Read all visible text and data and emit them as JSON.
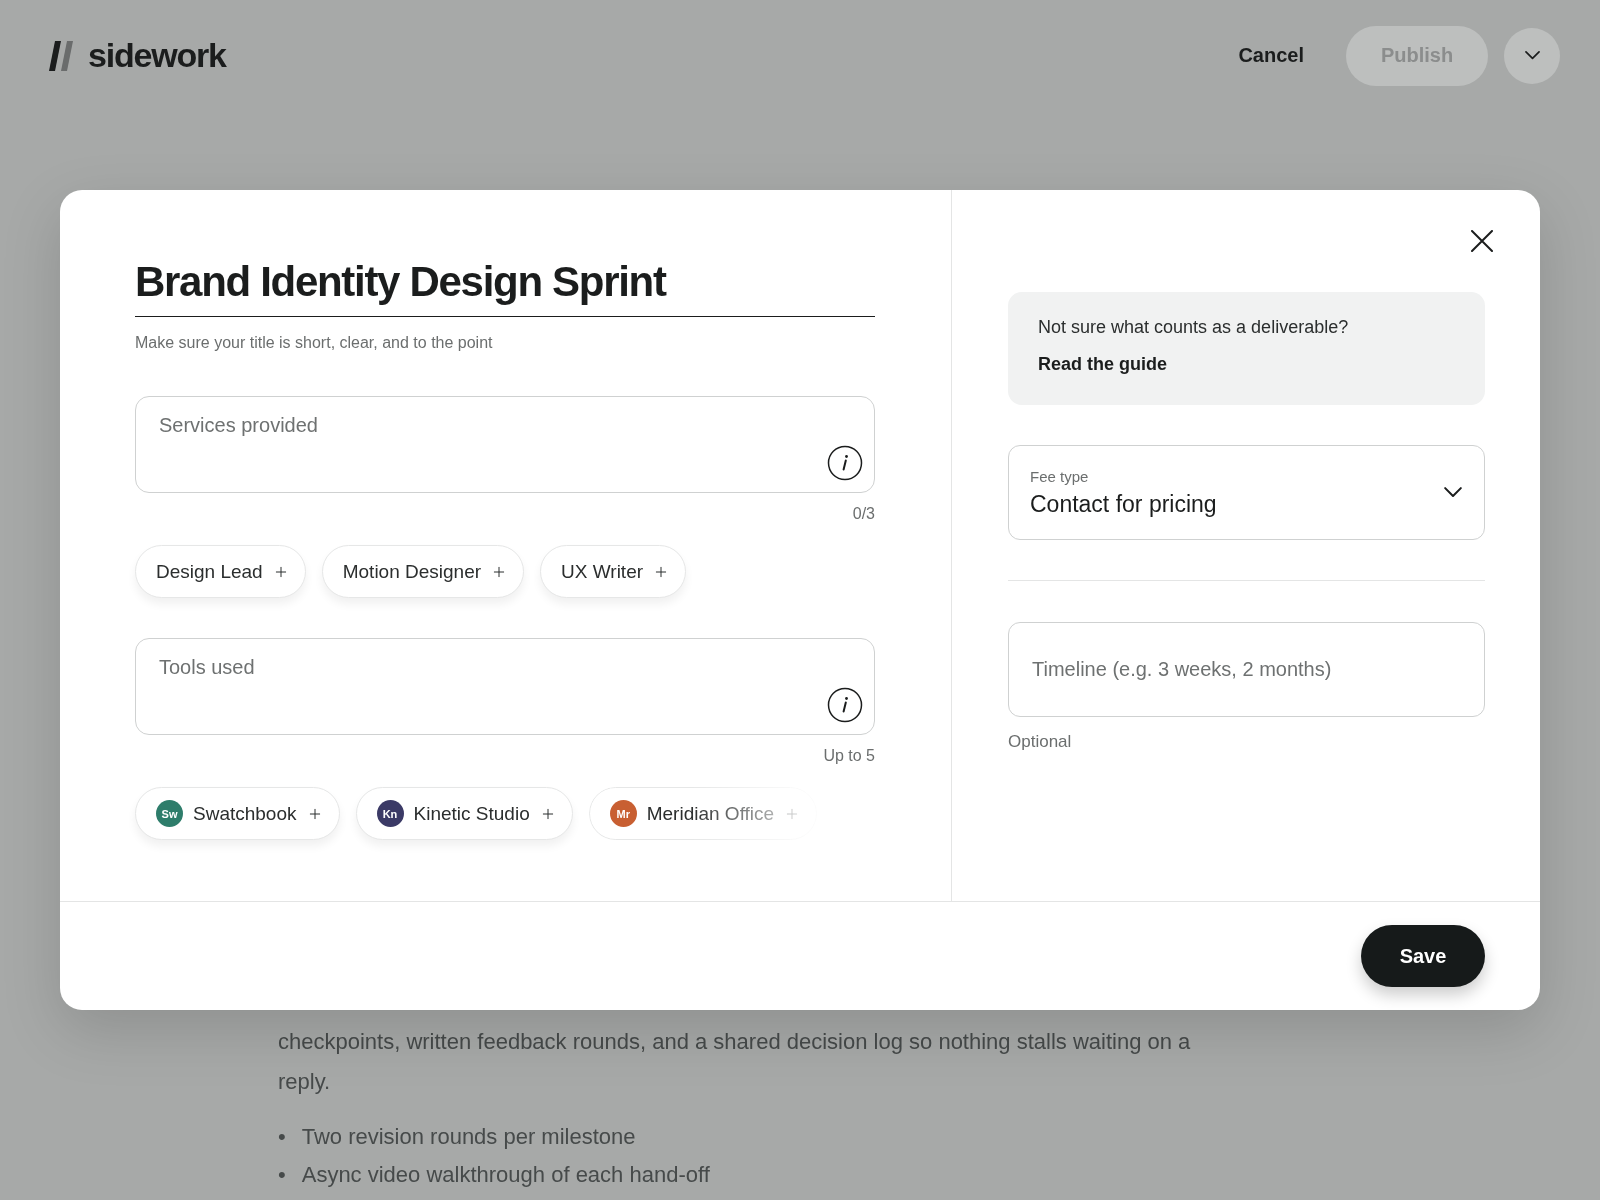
{
  "header": {
    "logo": "sidework",
    "cancel": "Cancel",
    "publish": {
      "label": "Publish",
      "disabled": true
    }
  },
  "background": {
    "paragraph": [
      "checkpoints, written feedback rounds, and a shared decision log so nothing stalls waiting on a",
      "reply."
    ],
    "bullets": [
      {
        "marker": "•",
        "text": "Two revision rounds per milestone"
      },
      {
        "marker": "•",
        "text": "Async video walkthrough of each hand-off"
      }
    ]
  },
  "dialog": {
    "title": {
      "value": "Brand Identity Design Sprint",
      "hint": "Make sure your title is short, clear, and to the point"
    },
    "services": {
      "placeholder": "Services provided",
      "counter": "0/3"
    },
    "service_chips": [
      {
        "label": "Design Lead"
      },
      {
        "label": "Motion Designer"
      },
      {
        "label": "UX Writer"
      }
    ],
    "tools": {
      "placeholder": "Tools used",
      "counter": "Up to 5"
    },
    "tool_chips": [
      {
        "label": "Swatchbook",
        "initials": "Sw",
        "color": "#2e7d6b",
        "faded": false
      },
      {
        "label": "Kinetic Studio",
        "initials": "Kn",
        "color": "#3b3a66",
        "faded": false
      },
      {
        "label": "Meridian Office",
        "initials": "Mr",
        "color": "#c85f32",
        "faded": true
      }
    ],
    "guide": {
      "text": "Not sure what counts as a deliverable?",
      "link": "Read the guide"
    },
    "fee_type": {
      "label": "Fee type",
      "value": "Contact for pricing"
    },
    "timeline": {
      "placeholder": "Timeline (e.g. 3 weeks, 2 months)",
      "hint": "Optional"
    },
    "save": "Save"
  }
}
